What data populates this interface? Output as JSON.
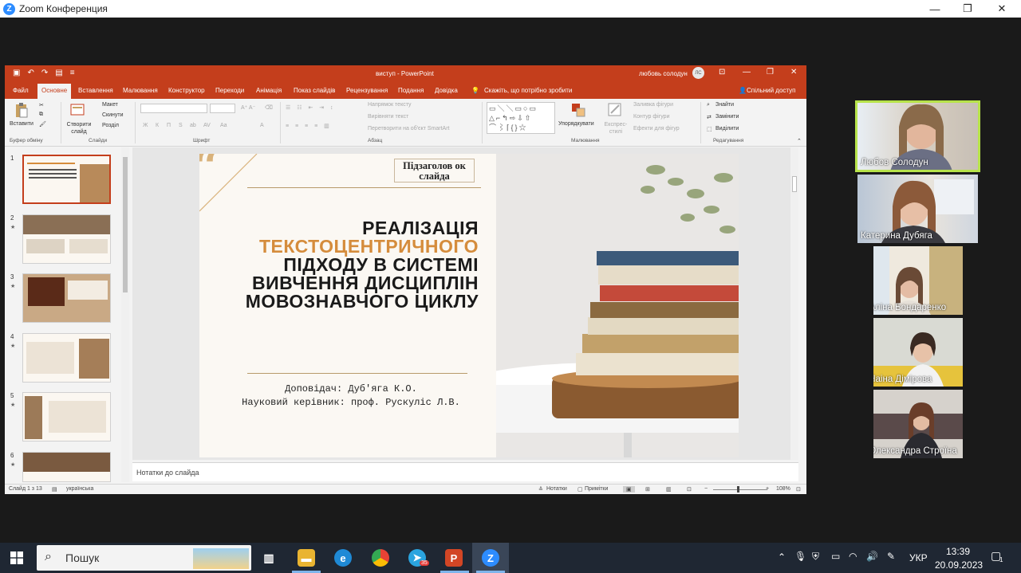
{
  "zoom": {
    "title": "Zoom Конференция",
    "logo": "Z",
    "controls": {
      "minimize": "—",
      "maximize": "❐",
      "close": "✕"
    }
  },
  "ppt": {
    "doc_title": "виступ  -  PowerPoint",
    "user_name": "любовь солодун",
    "user_initials": "ЛС",
    "window_controls": {
      "ribbon": "⊡",
      "minimize": "—",
      "maximize": "❐",
      "close": "✕"
    },
    "tabs": [
      "Файл",
      "Основне",
      "Вставлення",
      "Малювання",
      "Конструктор",
      "Переходи",
      "Анімація",
      "Показ слайдів",
      "Рецензування",
      "Подання",
      "Довідка"
    ],
    "active_tab": "Основне",
    "tell_me": "Скажіть, що потрібно зробити",
    "share": "Спільний доступ",
    "ribbon": {
      "paste": "Вставити",
      "clipboard_group": "Буфер обміну",
      "new_slide": "Створити слайд",
      "layout": "Макет",
      "reset": "Скинути",
      "section": "Розділ",
      "slides_group": "Слайди",
      "font_group": "Шрифт",
      "paragraph_group": "Абзац",
      "text_direction": "Напрямок тексту",
      "align_text": "Вирівняти текст",
      "convert_smartart": "Перетворити на об'єкт SmartArt",
      "arrange": "Упорядкувати",
      "quick_styles": "Експрес-стилі",
      "shape_fill": "Заливка фігури",
      "shape_outline": "Контур фігури",
      "shape_effects": "Ефекти для фігур",
      "drawing_group": "Малювання",
      "find": "Знайти",
      "replace": "Замінити",
      "select": "Виділити",
      "editing_group": "Редагування",
      "font_buttons": [
        "Ж",
        "К",
        "П",
        "S",
        "ab",
        "AV",
        "Aa",
        "A"
      ]
    },
    "thumbnails": [
      {
        "num": "1",
        "star": ""
      },
      {
        "num": "2",
        "star": "★"
      },
      {
        "num": "3",
        "star": "★"
      },
      {
        "num": "4",
        "star": "★"
      },
      {
        "num": "5",
        "star": "★"
      },
      {
        "num": "6",
        "star": "★"
      }
    ],
    "slide": {
      "quote_mark": "“",
      "subtitle": "Підзаголов ок слайда",
      "title_line1": "РЕАЛІЗАЦІЯ",
      "title_accent": "ТЕКСТОЦЕНТРИЧНОГО",
      "title_rest": "ПІДХОДУ В СИСТЕМІ ВИВЧЕННЯ ДИСЦИПЛІН МОВОЗНАВЧОГО ЦИКЛУ",
      "speaker": "Доповідач: Дуб'яга К.О.",
      "advisor": "Науковий керівник: проф. Рускуліс Л.В."
    },
    "notes_placeholder": "Нотатки до слайда",
    "status": {
      "slide_count": "Слайд 1 з 13",
      "language": "українська",
      "notes": "Нотатки",
      "comments": "Примітки",
      "zoom": "108%"
    }
  },
  "participants": [
    {
      "name": "Любов Солодун",
      "muted": false,
      "active": true
    },
    {
      "name": "Катерина Дубяга",
      "muted": false,
      "active": false
    },
    {
      "name": "Аліна Бондаренко",
      "muted": true,
      "active": false
    },
    {
      "name": "Наіна Дімірова",
      "muted": true,
      "active": false
    },
    {
      "name": "Олександра Строїна",
      "muted": true,
      "active": false
    }
  ],
  "taskbar": {
    "search_placeholder": "Пошук",
    "language": "УКР",
    "time": "13:39",
    "date": "20.09.2023",
    "notification_count": "1",
    "telegram_badge": "35"
  },
  "colors": {
    "ppt_accent": "#c43e1c",
    "slide_accent": "#d58c3c",
    "active_speaker": "#b7e34a",
    "taskbar": "#1f2733"
  }
}
